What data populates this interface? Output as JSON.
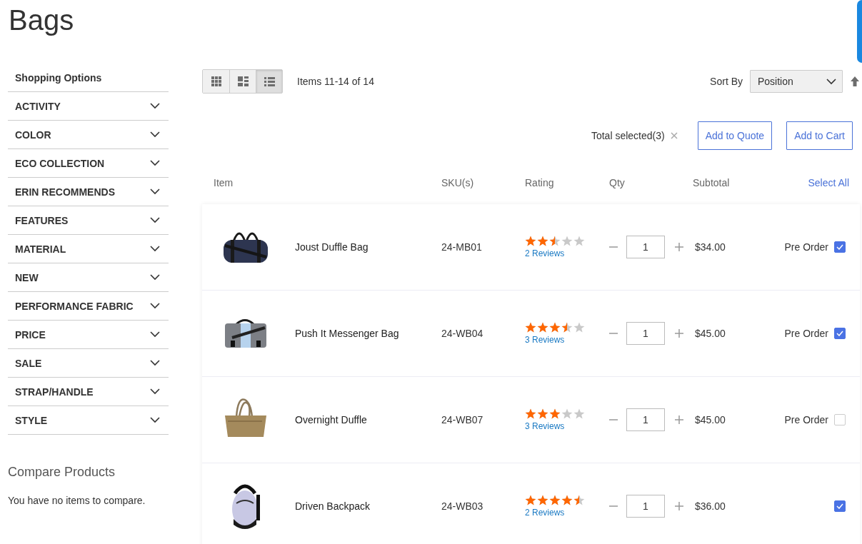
{
  "page_title": "Bags",
  "sidebar": {
    "heading": "Shopping Options",
    "filters": [
      {
        "label": "ACTIVITY",
        "expanded": false
      },
      {
        "label": "COLOR",
        "expanded": false
      },
      {
        "label": "ECO COLLECTION",
        "expanded": false
      },
      {
        "label": "ERIN RECOMMENDS",
        "expanded": false
      },
      {
        "label": "FEATURES",
        "expanded": false
      },
      {
        "label": "MATERIAL",
        "expanded": false
      },
      {
        "label": "NEW",
        "expanded": false
      },
      {
        "label": "PERFORMANCE FABRIC",
        "expanded": false
      },
      {
        "label": "PRICE",
        "expanded": false
      },
      {
        "label": "SALE",
        "expanded": false
      },
      {
        "label": "STRAP/HANDLE",
        "expanded": false
      },
      {
        "label": "STYLE",
        "expanded": false
      }
    ],
    "compare": {
      "title": "Compare Products",
      "message": "You have no items to compare."
    }
  },
  "toolbar": {
    "view_modes": [
      {
        "kind": "grid",
        "selected": false
      },
      {
        "kind": "tiles",
        "selected": false
      },
      {
        "kind": "list",
        "selected": true
      }
    ],
    "items_count": "Items 11-14 of 14",
    "sort_label": "Sort By",
    "sort_value": "Position"
  },
  "actions": {
    "total_selected": "Total selected(3)",
    "buttons": [
      "Add to Quote",
      "Add to Cart"
    ]
  },
  "table": {
    "columns": [
      "Item",
      "SKU(s)",
      "Rating",
      "Qty",
      "Subtotal"
    ],
    "select_all": "Select All",
    "rows": [
      {
        "name": "Joust Duffle Bag",
        "sku": "24-MB01",
        "stars": 2.5,
        "reviews": "2 Reviews",
        "qty": "1",
        "subtotal": "$34.00",
        "preorder_label": "Pre Order",
        "checked": true
      },
      {
        "name": "Push It Messenger Bag",
        "sku": "24-WB04",
        "stars": 3.5,
        "reviews": "3 Reviews",
        "qty": "1",
        "subtotal": "$45.00",
        "preorder_label": "Pre Order",
        "checked": true
      },
      {
        "name": "Overnight Duffle",
        "sku": "24-WB07",
        "stars": 3,
        "reviews": "3 Reviews",
        "qty": "1",
        "subtotal": "$45.00",
        "preorder_label": "Pre Order",
        "checked": false
      },
      {
        "name": "Driven Backpack",
        "sku": "24-WB03",
        "stars": 4.5,
        "reviews": "2 Reviews",
        "qty": "1",
        "subtotal": "$36.00",
        "checked": true
      }
    ]
  }
}
